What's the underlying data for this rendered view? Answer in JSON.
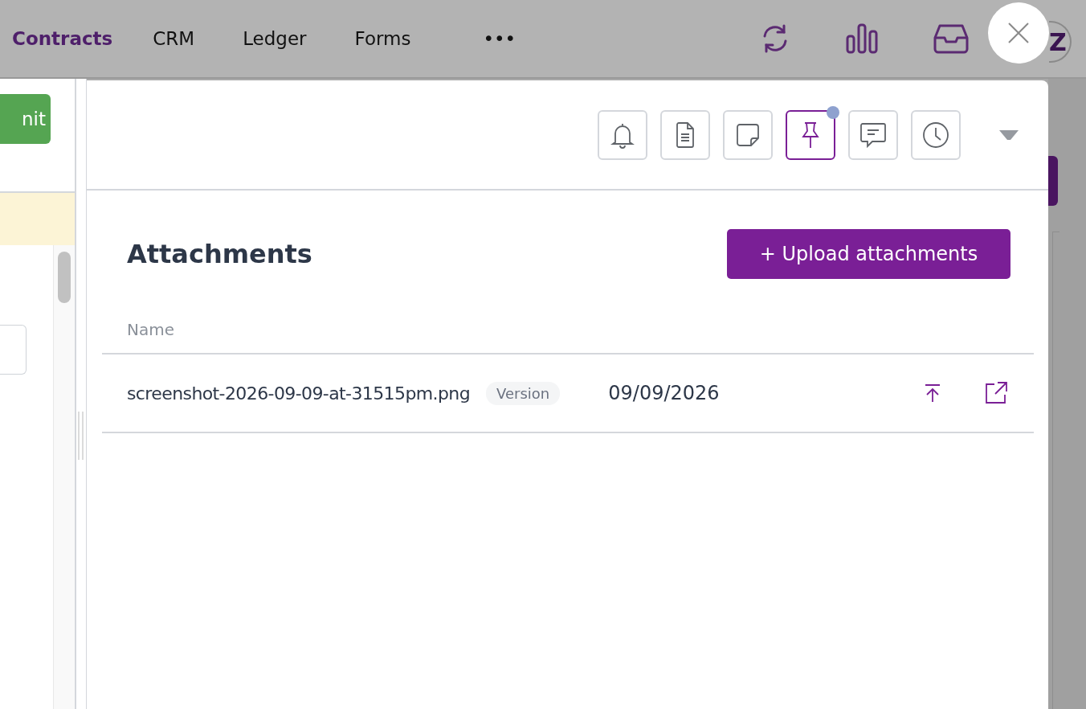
{
  "nav": {
    "items": [
      {
        "label": "Contracts",
        "selected": true
      },
      {
        "label": "CRM",
        "selected": false
      },
      {
        "label": "Ledger",
        "selected": false
      },
      {
        "label": "Forms",
        "selected": false
      },
      {
        "label": "•••",
        "selected": false
      }
    ],
    "avatar": {
      "initial": "Z"
    }
  },
  "background": {
    "button": "nit"
  },
  "drawer": {
    "tabs": [
      {
        "kind": "bell",
        "selected": false,
        "notification": false
      },
      {
        "kind": "document",
        "selected": false,
        "notification": false
      },
      {
        "kind": "note",
        "selected": false,
        "notification": false
      },
      {
        "kind": "pin",
        "selected": true,
        "notification": true
      },
      {
        "kind": "comment",
        "selected": false,
        "notification": false
      },
      {
        "kind": "clock",
        "selected": false,
        "notification": false
      }
    ],
    "title": "Attachments",
    "upload_button": "+ Upload attachments",
    "table": {
      "columns": [
        "Name"
      ],
      "rows": [
        {
          "name": "screenshot-2026-09-09-at-31515pm.png",
          "tag": "Version",
          "date": "09/09/2026"
        }
      ]
    }
  }
}
